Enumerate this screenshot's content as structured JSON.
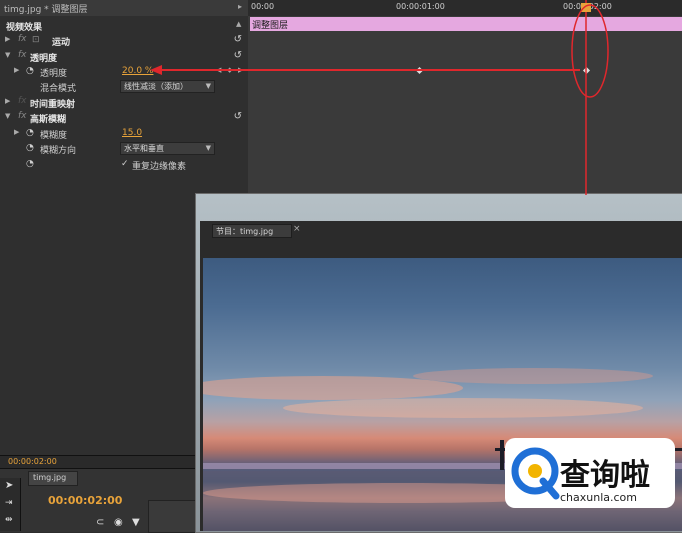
{
  "effect_controls": {
    "header_title": "timg.jpg * 调整图层",
    "header_arrow": "▸",
    "video_effects_label": "视频效果",
    "rows": {
      "motion": "运动",
      "opacity": "透明度",
      "opacity_prop": "透明度",
      "opacity_value": "20.0 %",
      "blend_mode_label": "混合模式",
      "blend_mode_value": "线性减淡（添加）",
      "time_remap": "时间重映射",
      "gaussian_blur": "高斯模糊",
      "blurriness_label": "模糊度",
      "blurriness_value": "15.0",
      "blur_direction_label": "模糊方向",
      "blur_direction_value": "水平和垂直",
      "repeat_edge_label": "重复边缘像素",
      "repeat_edge_checked": "✓"
    },
    "fx_mark": "fx",
    "reset_glyph": "↺"
  },
  "timeline_ruler": {
    "ticks": [
      "00:00",
      "00:00:01:00",
      "00:00:02:00"
    ]
  },
  "clip": {
    "label": "调整图层"
  },
  "current_time": "00:00:02:00",
  "timeline_panel": {
    "tab_label": "timg.jpg",
    "timecode": "00:00:02:00"
  },
  "program_monitor": {
    "tab_label": "节目：timg.jpg",
    "close_glyph": "×"
  },
  "watermark": {
    "title": "查询啦",
    "subtitle": "chaxunla.com"
  },
  "colors": {
    "accent_value": "#e8a33a",
    "clip": "#e5a8e0",
    "annotation": "#e0272c"
  }
}
